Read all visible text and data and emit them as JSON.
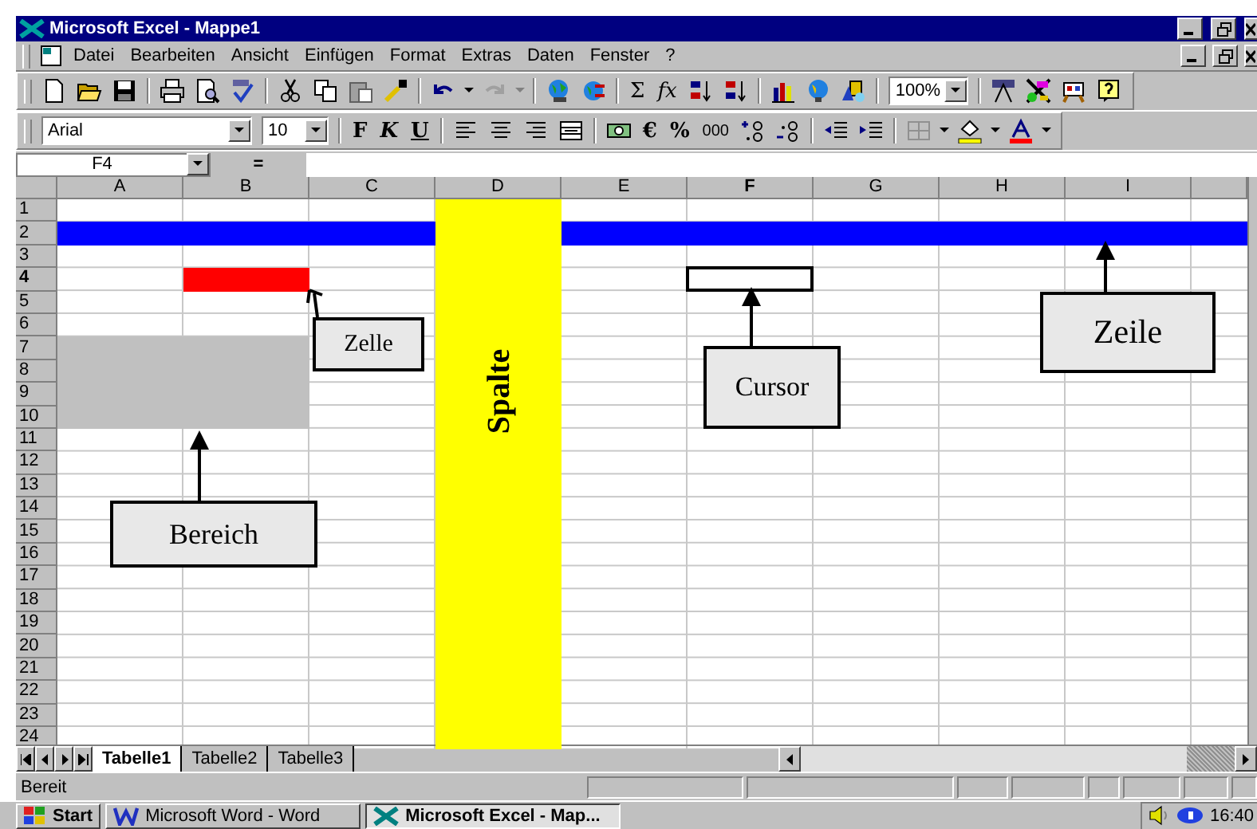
{
  "window": {
    "title": "Microsoft Excel - Mappe1"
  },
  "menu": [
    "Datei",
    "Bearbeiten",
    "Ansicht",
    "Einfügen",
    "Format",
    "Extras",
    "Daten",
    "Fenster",
    "?"
  ],
  "standard_toolbar": {
    "sum": "Σ",
    "function": "fx",
    "zoom": "100%"
  },
  "formatting_toolbar": {
    "font": "Arial",
    "size": "10",
    "bold": "F",
    "italic": "K",
    "underline": "U",
    "currency": "€",
    "percent": "%",
    "thousands": "000"
  },
  "formula_bar": {
    "name_box": "F4",
    "equals": "="
  },
  "columns": [
    {
      "label": "A",
      "selected": false
    },
    {
      "label": "B",
      "selected": false
    },
    {
      "label": "C",
      "selected": false
    },
    {
      "label": "D",
      "selected": false,
      "color": "#ffff00"
    },
    {
      "label": "E",
      "selected": false
    },
    {
      "label": "F",
      "selected": true
    },
    {
      "label": "G",
      "selected": false
    },
    {
      "label": "H",
      "selected": false
    },
    {
      "label": "I",
      "selected": false
    }
  ],
  "rows": [
    {
      "label": "1",
      "selected": false
    },
    {
      "label": "2",
      "selected": false,
      "color": "#0000ff"
    },
    {
      "label": "3",
      "selected": false
    },
    {
      "label": "4",
      "selected": true,
      "cells": [
        {
          "filled": false
        },
        {
          "filled": true,
          "color": "#ff0000"
        }
      ]
    },
    {
      "label": "5",
      "selected": false
    },
    {
      "label": "6",
      "selected": false
    },
    {
      "label": "7",
      "selected": false,
      "cells": [
        {
          "filled": true,
          "color": "#c0c0c0"
        },
        {
          "filled": true,
          "color": "#c0c0c0"
        }
      ]
    },
    {
      "label": "8",
      "selected": false,
      "cells": [
        {
          "filled": true,
          "color": "#c0c0c0"
        },
        {
          "filled": true,
          "color": "#c0c0c0"
        }
      ]
    },
    {
      "label": "9",
      "selected": false,
      "cells": [
        {
          "filled": true,
          "color": "#c0c0c0"
        },
        {
          "filled": true,
          "color": "#c0c0c0"
        }
      ]
    },
    {
      "label": "10",
      "selected": false,
      "cells": [
        {
          "filled": true,
          "color": "#c0c0c0"
        },
        {
          "filled": true,
          "color": "#c0c0c0"
        }
      ]
    },
    {
      "label": "11",
      "selected": false
    },
    {
      "label": "12",
      "selected": false
    },
    {
      "label": "13",
      "selected": false
    },
    {
      "label": "14",
      "selected": false
    },
    {
      "label": "15",
      "selected": false
    },
    {
      "label": "16",
      "selected": false
    },
    {
      "label": "17",
      "selected": false
    },
    {
      "label": "18",
      "selected": false
    },
    {
      "label": "19",
      "selected": false
    },
    {
      "label": "20",
      "selected": false
    },
    {
      "label": "21",
      "selected": false
    },
    {
      "label": "22",
      "selected": false
    },
    {
      "label": "23",
      "selected": false
    },
    {
      "label": "24",
      "selected": false
    }
  ],
  "annotations": [
    {
      "text": "Zelle",
      "kind": "box"
    },
    {
      "text": "Spalte",
      "kind": "vertical"
    },
    {
      "text": "Cursor",
      "kind": "box"
    },
    {
      "text": "Zeile",
      "kind": "box"
    },
    {
      "text": "Bereich",
      "kind": "box"
    }
  ],
  "sheet_tabs": [
    {
      "label": "Tabelle1",
      "selected": true
    },
    {
      "label": "Tabelle2",
      "selected": false
    },
    {
      "label": "Tabelle3",
      "selected": false
    }
  ],
  "status_bar": {
    "text": "Bereit"
  },
  "taskbar": {
    "start": "Start",
    "tasks": [
      {
        "label": "Microsoft Word - Word",
        "kind": "word",
        "selected": false
      },
      {
        "label": "Microsoft Excel - Map...",
        "kind": "excel",
        "selected": true
      }
    ],
    "clock": "16:40"
  }
}
